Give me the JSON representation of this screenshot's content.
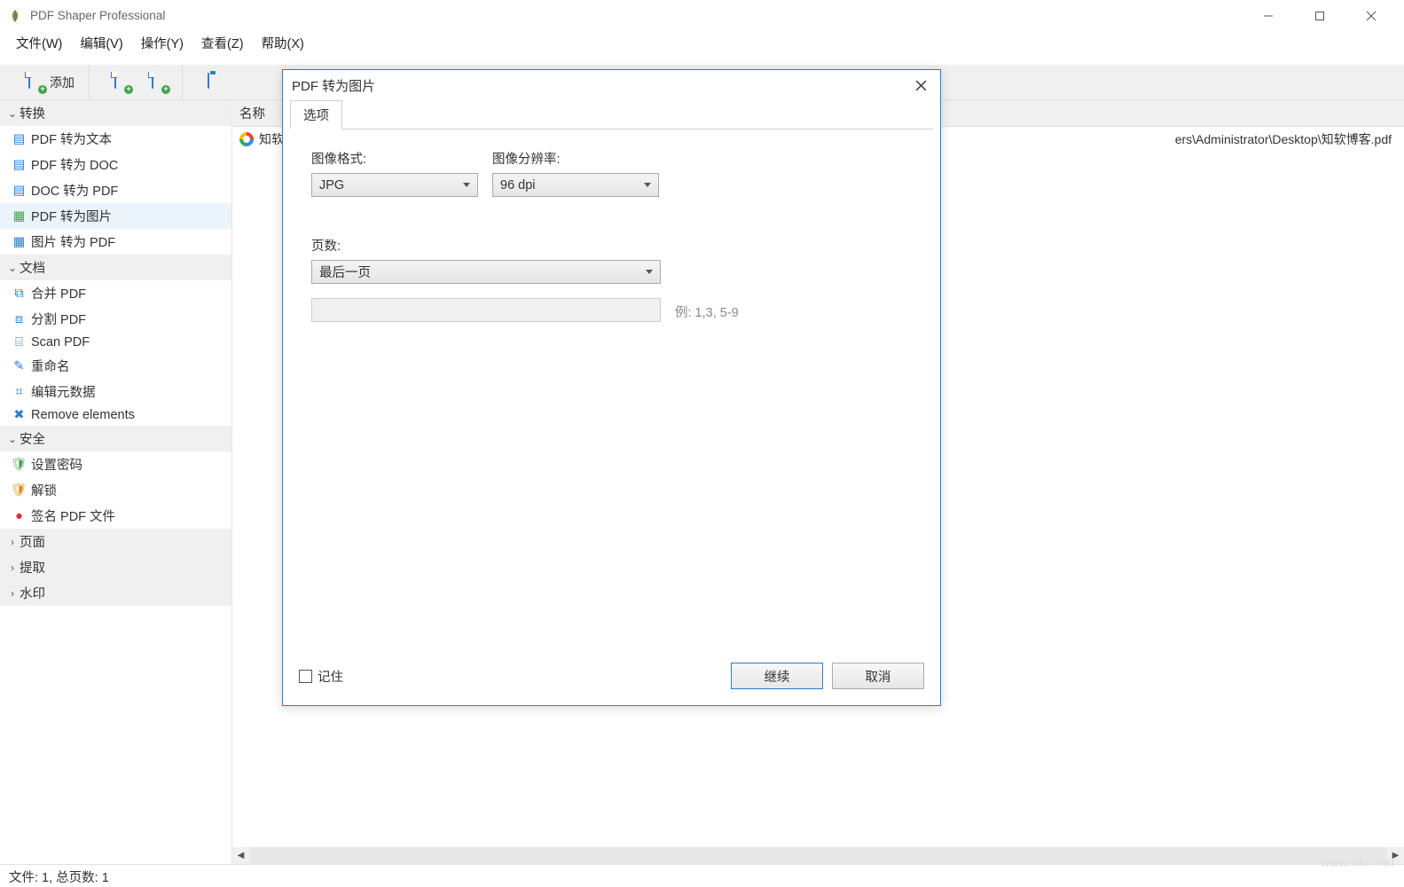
{
  "app": {
    "title": "PDF Shaper Professional"
  },
  "menu": [
    "文件(W)",
    "编辑(V)",
    "操作(Y)",
    "查看(Z)",
    "帮助(X)"
  ],
  "toolbar": {
    "add_label": "添加"
  },
  "sidebar": {
    "groups": [
      {
        "label": "转换",
        "expanded": true,
        "items": [
          {
            "label": "PDF 转为文本"
          },
          {
            "label": "PDF 转为 DOC"
          },
          {
            "label": "DOC 转为 PDF"
          },
          {
            "label": "PDF 转为图片",
            "selected": true
          },
          {
            "label": "图片 转为 PDF"
          }
        ]
      },
      {
        "label": "文档",
        "expanded": true,
        "items": [
          {
            "label": "合并 PDF"
          },
          {
            "label": "分割 PDF"
          },
          {
            "label": "Scan PDF"
          },
          {
            "label": "重命名"
          },
          {
            "label": "编辑元数据"
          },
          {
            "label": "Remove elements"
          }
        ]
      },
      {
        "label": "安全",
        "expanded": true,
        "items": [
          {
            "label": "设置密码"
          },
          {
            "label": "解锁"
          },
          {
            "label": "签名 PDF 文件"
          }
        ]
      },
      {
        "label": "页面",
        "expanded": false,
        "items": []
      },
      {
        "label": "提取",
        "expanded": false,
        "items": []
      },
      {
        "label": "水印",
        "expanded": false,
        "items": []
      }
    ]
  },
  "filelist": {
    "column_name": "名称",
    "rows": [
      {
        "name_truncated": "知软",
        "path_tail": "ers\\Administrator\\Desktop\\知软博客.pdf"
      }
    ]
  },
  "statusbar": "文件: 1, 总页数: 1",
  "dialog": {
    "title": "PDF 转为图片",
    "tab": "选项",
    "format_label": "图像格式:",
    "format_value": "JPG",
    "dpi_label": "图像分辨率:",
    "dpi_value": "96 dpi",
    "pages_label": "页数:",
    "pages_value": "最后一页",
    "example_hint": "例: 1,3, 5-9",
    "remember": "记住",
    "continue": "继续",
    "cancel": "取消"
  },
  "watermark": "www.kkx.net"
}
